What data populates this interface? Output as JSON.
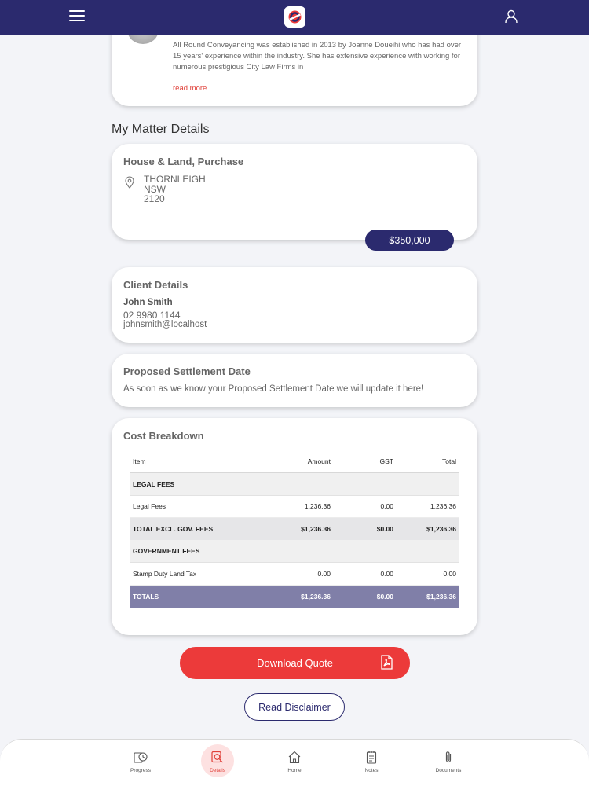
{
  "topbar": {
    "menu_icon": "hamburger-icon",
    "logo": "app-logo",
    "user_icon": "user-icon",
    "bg_color": "#2b2a6e"
  },
  "about": {
    "text": "All Round Conveyancing was established in 2013 by Joanne Doueihi who has had over 15 years' experience within the industry. She has extensive experience with working for numerous prestigious City Law Firms in",
    "ellipsis": "...",
    "read_more": "read more"
  },
  "section_heading": "My Matter Details",
  "matter": {
    "title": "House & Land, Purchase",
    "suburb": "THORNLEIGH",
    "state": "NSW",
    "postcode": "2120",
    "price": "$350,000"
  },
  "client": {
    "title": "Client Details",
    "name": "John Smith",
    "phone": "02 9980 1144",
    "email": "johnsmith@localhost"
  },
  "settlement": {
    "title": "Proposed Settlement Date",
    "text": "As soon as we know your Proposed Settlement Date we will update it here!"
  },
  "cost": {
    "title": "Cost Breakdown",
    "headers": {
      "item": "Item",
      "amount": "Amount",
      "gst": "GST",
      "total": "Total"
    },
    "legal_group": "LEGAL FEES",
    "legal_row": {
      "item": "Legal Fees",
      "amount": "1,236.36",
      "gst": "0.00",
      "total": "1,236.36"
    },
    "subtotal_row": {
      "item": "TOTAL EXCL. GOV. FEES",
      "amount": "$1,236.36",
      "gst": "$0.00",
      "total": "$1,236.36"
    },
    "gov_group": "GOVERNMENT FEES",
    "gov_row": {
      "item": "Stamp Duty Land Tax",
      "amount": "0.00",
      "gst": "0.00",
      "total": "0.00"
    },
    "totals_row": {
      "item": "TOTALS",
      "amount": "$1,236.36",
      "gst": "$0.00",
      "total": "$1,236.36"
    }
  },
  "actions": {
    "download": "Download Quote",
    "disclaimer": "Read Disclaimer"
  },
  "nav": {
    "progress": "Progress",
    "details": "Details",
    "home": "Home",
    "notes": "Notes",
    "documents": "Documents",
    "active": "Details",
    "accent_color": "#e0413a"
  }
}
